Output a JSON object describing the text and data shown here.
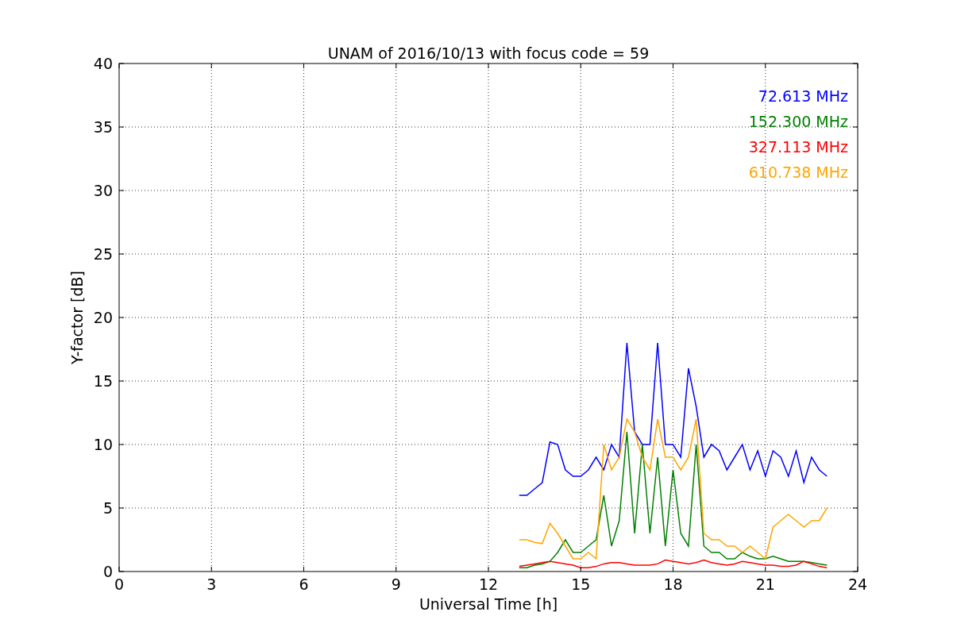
{
  "chart": {
    "chart_data": {
      "type": "line",
      "title": "UNAM of 2016/10/13 with focus code = 59",
      "xlabel": "Universal Time [h]",
      "ylabel": "Y-factor [dB]",
      "x": [
        13,
        13.25,
        13.5,
        13.75,
        14,
        14.25,
        14.5,
        14.75,
        15,
        15.25,
        15.5,
        15.75,
        16,
        16.25,
        16.5,
        16.75,
        17,
        17.25,
        17.5,
        17.75,
        18,
        18.25,
        18.5,
        18.75,
        19,
        19.25,
        19.5,
        19.75,
        20,
        20.25,
        20.5,
        20.75,
        21,
        21.25,
        21.5,
        21.75,
        22,
        22.25,
        22.5,
        22.75,
        23
      ],
      "series": [
        {
          "name": "72.613 MHz",
          "color": "#0000ff",
          "values": [
            6,
            6,
            6.5,
            7,
            10.2,
            10,
            8,
            7.5,
            7.5,
            8,
            9,
            8,
            10,
            9,
            18,
            11,
            10,
            10,
            18,
            10,
            10,
            9,
            16,
            13,
            9,
            10,
            9.5,
            8,
            9,
            10,
            8,
            9.5,
            7.5,
            9.5,
            9,
            7.5,
            9.5,
            7,
            9,
            8,
            7.5
          ]
        },
        {
          "name": "152.300 MHz",
          "color": "#008000",
          "values": [
            0.3,
            0.3,
            0.5,
            0.6,
            0.8,
            1.5,
            2.5,
            1.5,
            1.5,
            2,
            2.5,
            6,
            2,
            4,
            11,
            3,
            10,
            3,
            9,
            2,
            8,
            3,
            2,
            10,
            2,
            1.5,
            1.5,
            1,
            1,
            1.5,
            1.2,
            1,
            1,
            1.2,
            1,
            0.8,
            0.8,
            0.8,
            0.7,
            0.6,
            0.5
          ]
        },
        {
          "name": "327.113 MHz",
          "color": "#ff0000",
          "values": [
            0.4,
            0.5,
            0.6,
            0.7,
            0.8,
            0.7,
            0.6,
            0.5,
            0.3,
            0.3,
            0.4,
            0.6,
            0.7,
            0.7,
            0.6,
            0.5,
            0.5,
            0.5,
            0.6,
            0.9,
            0.8,
            0.7,
            0.6,
            0.7,
            0.9,
            0.7,
            0.6,
            0.5,
            0.6,
            0.8,
            0.7,
            0.6,
            0.5,
            0.5,
            0.4,
            0.4,
            0.5,
            0.8,
            0.6,
            0.4,
            0.3
          ]
        },
        {
          "name": "610.738 MHz",
          "color": "#ffa500",
          "values": [
            2.5,
            2.5,
            2.3,
            2.2,
            3.8,
            3,
            2,
            1,
            1,
            1.5,
            1,
            10,
            8,
            9,
            12,
            11,
            9,
            8,
            12,
            9,
            9,
            8,
            9,
            12,
            3,
            2.5,
            2.5,
            2,
            2,
            1.5,
            2,
            1.5,
            1,
            3.5,
            4,
            4.5,
            4,
            3.5,
            4,
            4,
            5
          ]
        }
      ],
      "xlim": [
        0,
        24
      ],
      "ylim": [
        0,
        40
      ],
      "xticks": [
        0,
        3,
        6,
        9,
        12,
        15,
        18,
        21,
        24
      ],
      "yticks": [
        0,
        5,
        10,
        15,
        20,
        25,
        30,
        35,
        40
      ],
      "grid": true
    }
  }
}
